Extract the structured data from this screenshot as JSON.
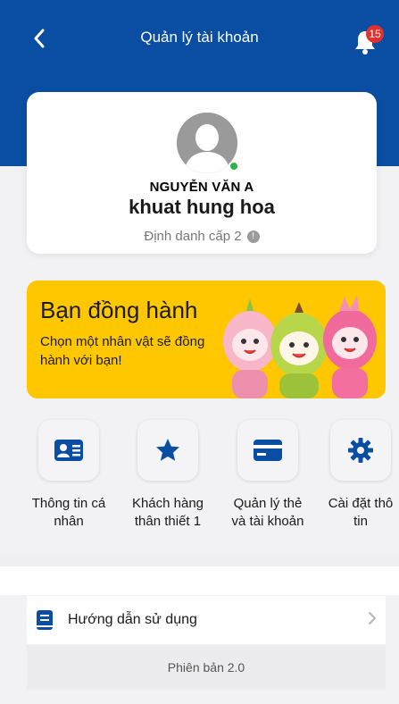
{
  "header": {
    "title": "Quản lý tài khoản",
    "notification_count": "15"
  },
  "profile": {
    "name_overlay": "NGUYỄN VĂN A",
    "name": "khuat hung hoa",
    "level": "Định danh cấp 2",
    "info_glyph": "!"
  },
  "companion": {
    "title": "Bạn đồng hành",
    "subtitle": "Chọn một nhân vật sẽ đồng hành với bạn!"
  },
  "quick_actions": [
    {
      "label": "Thông tin cá\nnhân",
      "icon": "id-card-icon"
    },
    {
      "label": "Khách hàng\nthân thiết 1",
      "icon": "star-icon"
    },
    {
      "label": "Quản lý thẻ\nvà tài khoản",
      "icon": "credit-card-icon"
    },
    {
      "label": "Cài đặt thô\ntin",
      "icon": "gear-icon"
    }
  ],
  "menu": {
    "guide_label": "Hướng dẫn sử dụng"
  },
  "footer": {
    "version": "Phiên bản 2.0"
  },
  "colors": {
    "header": "#0a4ea3",
    "accent": "#0a4ea3",
    "banner": "#ffc700",
    "badge": "#e0312f",
    "online": "#2fb24a"
  }
}
